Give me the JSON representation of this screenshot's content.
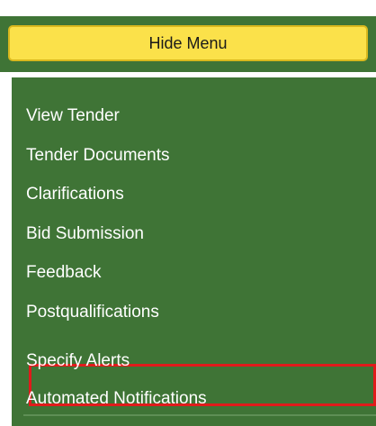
{
  "menu": {
    "toggle_label": "Hide Menu",
    "items": [
      {
        "label": "View Tender",
        "selected": false
      },
      {
        "label": "Tender Documents",
        "selected": false
      },
      {
        "label": "Clarifications",
        "selected": false
      },
      {
        "label": "Bid Submission",
        "selected": false
      },
      {
        "label": "Feedback",
        "selected": false
      },
      {
        "label": "Postqualifications",
        "selected": true
      },
      {
        "label": "Specify Alerts",
        "selected": false
      },
      {
        "label": "Automated Notifications",
        "selected": false
      }
    ]
  },
  "colors": {
    "menu_background": "#3f7436",
    "toggle_background": "#fbe14a",
    "item_text": "#ffffff",
    "selected_outline": "#e01b1b"
  }
}
